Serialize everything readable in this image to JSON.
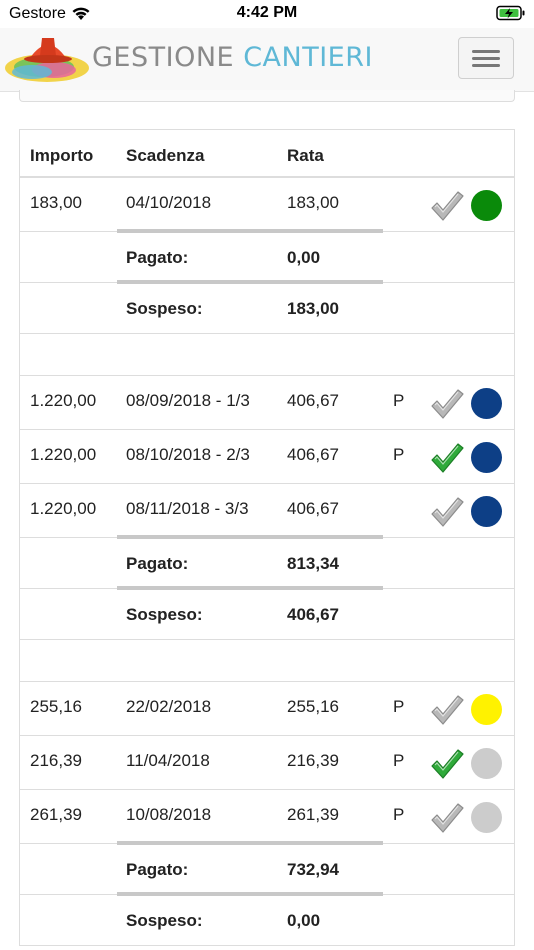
{
  "status_bar": {
    "carrier": "Gestore",
    "time": "4:42 PM"
  },
  "navbar": {
    "brand_part1": "GESTIONE",
    "brand_part2": "CANTIERI"
  },
  "table": {
    "headers": {
      "importo": "Importo",
      "scadenza": "Scadenza",
      "rata": "Rata"
    },
    "groups": [
      {
        "rows": [
          {
            "importo": "183,00",
            "scadenza": "04/10/2018",
            "rata": "183,00",
            "p": "",
            "checked": false,
            "status_color": "#0a8a0a"
          }
        ],
        "pagato_label": "Pagato:",
        "pagato": "0,00",
        "sospeso_label": "Sospeso:",
        "sospeso": "183,00"
      },
      {
        "rows": [
          {
            "importo": "1.220,00",
            "scadenza": "08/09/2018 - 1/3",
            "rata": "406,67",
            "p": "P",
            "checked": false,
            "status_color": "#0d3f86"
          },
          {
            "importo": "1.220,00",
            "scadenza": "08/10/2018 - 2/3",
            "rata": "406,67",
            "p": "P",
            "checked": true,
            "status_color": "#0d3f86"
          },
          {
            "importo": "1.220,00",
            "scadenza": "08/11/2018 - 3/3",
            "rata": "406,67",
            "p": "",
            "checked": false,
            "status_color": "#0d3f86"
          }
        ],
        "pagato_label": "Pagato:",
        "pagato": "813,34",
        "sospeso_label": "Sospeso:",
        "sospeso": "406,67"
      },
      {
        "rows": [
          {
            "importo": "255,16",
            "scadenza": "22/02/2018",
            "rata": "255,16",
            "p": "P",
            "checked": false,
            "status_color": "#fff200"
          },
          {
            "importo": "216,39",
            "scadenza": "11/04/2018",
            "rata": "216,39",
            "p": "P",
            "checked": true,
            "status_color": "#cccccc"
          },
          {
            "importo": "261,39",
            "scadenza": "10/08/2018",
            "rata": "261,39",
            "p": "P",
            "checked": false,
            "status_color": "#cccccc"
          }
        ],
        "pagato_label": "Pagato:",
        "pagato": "732,94",
        "sospeso_label": "Sospeso:",
        "sospeso": "0,00"
      }
    ]
  }
}
